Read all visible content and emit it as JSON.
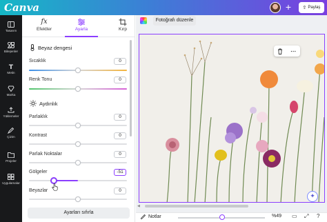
{
  "app": {
    "logo": "Canva",
    "share_label": "Paylaş"
  },
  "rail": [
    {
      "label": "Tasarım",
      "icon": "layout-icon"
    },
    {
      "label": "Bileşenler",
      "icon": "elements-icon"
    },
    {
      "label": "Metin",
      "icon": "text-icon"
    },
    {
      "label": "Marka",
      "icon": "brand-icon"
    },
    {
      "label": "Yüklemeler",
      "icon": "upload-icon"
    },
    {
      "label": "Çizim",
      "icon": "draw-icon"
    },
    {
      "label": "Projeler",
      "icon": "folder-icon"
    },
    {
      "label": "Uygulamalar",
      "icon": "apps-icon"
    }
  ],
  "tabs": [
    {
      "label": "Efektler",
      "icon": "fx-icon"
    },
    {
      "label": "Ayarla",
      "icon": "sliders-icon"
    },
    {
      "label": "Kırp",
      "icon": "crop-icon"
    }
  ],
  "white_balance": {
    "heading": "Beyaz dengesi",
    "rows": [
      {
        "label": "Sıcaklık",
        "value": "0"
      },
      {
        "label": "Renk Tonu",
        "value": "0"
      }
    ]
  },
  "light": {
    "heading": "Aydınlık",
    "rows": [
      {
        "label": "Parlaklık",
        "value": "0"
      },
      {
        "label": "Kontrast",
        "value": "0"
      },
      {
        "label": "Parlak Noktalar",
        "value": "0"
      },
      {
        "label": "Gölgeler",
        "value": "-51"
      },
      {
        "label": "Beyazlar",
        "value": "0"
      }
    ]
  },
  "reset_label": "Ayarları sıfırla",
  "toolbar": {
    "photo_edit_label": "Fotoğrafı düzenle"
  },
  "bottom": {
    "notes_label": "Notlar",
    "zoom": "%49"
  },
  "colors": {
    "accent": "#8b3dff",
    "rail_bg": "#18191b"
  }
}
